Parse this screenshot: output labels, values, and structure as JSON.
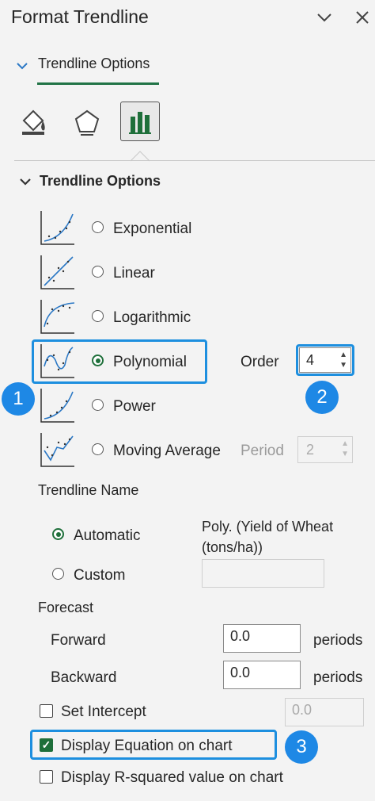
{
  "header": {
    "title": "Format Trendline"
  },
  "tab": {
    "label": "Trendline Options"
  },
  "categories": [
    "fill-line",
    "effects",
    "trendline-options"
  ],
  "section": {
    "title": "Trendline Options"
  },
  "types": {
    "exponential": {
      "label": "Exponential",
      "selected": false
    },
    "linear": {
      "label": "Linear",
      "selected": false
    },
    "logarithmic": {
      "label": "Logarithmic",
      "selected": false
    },
    "polynomial": {
      "label": "Polynomial",
      "selected": true
    },
    "power": {
      "label": "Power",
      "selected": false
    },
    "moving_average": {
      "label": "Moving Average",
      "selected": false
    }
  },
  "order": {
    "label": "Order",
    "value": "4"
  },
  "period": {
    "label": "Period",
    "value": "2"
  },
  "name": {
    "heading": "Trendline Name",
    "automatic_label": "Automatic",
    "automatic_value_line1": "Poly. (Yield of Wheat",
    "automatic_value_line2": "(tons/ha))",
    "custom_label": "Custom",
    "custom_value": ""
  },
  "forecast": {
    "heading": "Forecast",
    "forward_label": "Forward",
    "forward_value": "0.0",
    "backward_label": "Backward",
    "backward_value": "0.0",
    "unit": "periods"
  },
  "intercept": {
    "label": "Set Intercept",
    "value": "0.0",
    "checked": false
  },
  "display_equation": {
    "label": "Display Equation on chart",
    "checked": true
  },
  "display_r2": {
    "label": "Display R-squared value on chart",
    "checked": false
  },
  "callouts": [
    "1",
    "2",
    "3"
  ],
  "colors": {
    "accent": "#217346",
    "highlight": "#1d8fdf",
    "badge": "#1e88e5"
  }
}
